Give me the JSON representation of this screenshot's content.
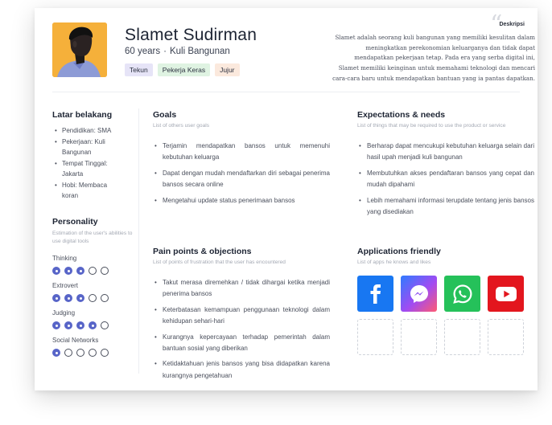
{
  "persona": {
    "name": "Slamet Sudirman",
    "age": "60 years",
    "separator": "·",
    "occupation": "Kuli Bangunan",
    "tags": [
      "Tekun",
      "Pekerja Keras",
      "Jujur"
    ]
  },
  "description": {
    "label": "Deskripsi",
    "text": "Slamet adalah seorang kuli bangunan yang memiliki kesulitan dalam meningkatkan perekonomian keluarganya dan tidak dapat mendapatkan pekerjaan tetap. Pada era yang serba digital ini, Slamet memiliki keinginan untuk memahami teknologi dan mencari cara-cara baru untuk mendapatkan bantuan yang ia pantas dapatkan."
  },
  "background": {
    "title": "Latar belakang",
    "items": [
      "Pendidikan: SMA",
      "Pekerjaan: Kuli Bangunan",
      "Tempat Tinggal: Jakarta",
      "Hobi: Membaca koran"
    ]
  },
  "personality": {
    "title": "Personality",
    "subtitle": "Estimation of the user's abilities to use digital tools",
    "traits": [
      {
        "label": "Thinking",
        "level": 3,
        "max": 5
      },
      {
        "label": "Extrovert",
        "level": 3,
        "max": 5
      },
      {
        "label": "Judging",
        "level": 4,
        "max": 5
      },
      {
        "label": "Social Networks",
        "level": 1,
        "max": 5
      }
    ]
  },
  "goals": {
    "title": "Goals",
    "subtitle": "List of others user goals",
    "items": [
      "Terjamin mendapatkan bansos untuk memenuhi kebutuhan keluarga",
      "Dapat dengan mudah mendaftarkan diri sebagai penerima bansos secara online",
      "Mengetahui update status penerimaan bansos"
    ]
  },
  "expectations": {
    "title": "Expectations & needs",
    "subtitle": "List of things that may be required to use the product or service",
    "items": [
      "Berharap dapat mencukupi kebutuhan keluarga selain dari hasil upah menjadi kuli bangunan",
      "Membutuhkan akses pendaftaran bansos yang cepat dan mudah dipahami",
      "Lebih memahami informasi terupdate tentang jenis bansos yang disediakan"
    ]
  },
  "pain_points": {
    "title": "Pain points & objections",
    "subtitle": "List of points of frustration that the user has encountered",
    "items": [
      "Takut merasa diremehkan / tidak dihargai ketika menjadi penerima bansos",
      "Keterbatasan kemampuan penggunaan teknologi dalam kehidupan sehari-hari",
      "Kurangnya kepercayaan terhadap pemerintah dalam bantuan sosial yang diberikan",
      "Ketidaktahuan jenis bansos yang bisa didapatkan karena kurangnya pengetahuan"
    ]
  },
  "apps": {
    "title": "Applications friendly",
    "subtitle": "List of apps he knows and likes",
    "items": [
      {
        "icon": "facebook-icon",
        "color": "#1877f2"
      },
      {
        "icon": "messenger-icon",
        "color": "#a14bf2"
      },
      {
        "icon": "whatsapp-icon",
        "color": "#25c15a"
      },
      {
        "icon": "youtube-icon",
        "color": "#e3161e"
      }
    ],
    "empty_slots": 4
  }
}
